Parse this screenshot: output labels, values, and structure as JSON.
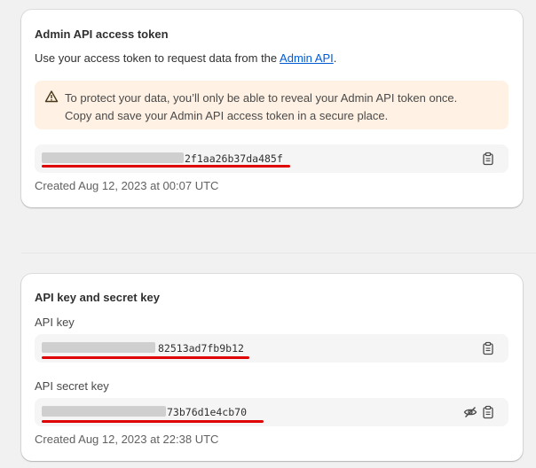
{
  "access_token_card": {
    "title": "Admin API access token",
    "description_prefix": "Use your access token to request data from the ",
    "description_link": "Admin API",
    "description_suffix": ".",
    "warning_line1": "To protect your data, you’ll only be able to reveal your Admin API token once.",
    "warning_line2": "Copy and save your Admin API access token in a secure place.",
    "token_visible_suffix": "2f1aa26b37da485f",
    "created": "Created Aug 12, 2023 at 00:07 UTC",
    "copy_icon": "clipboard-icon",
    "warning_icon": "warning-icon"
  },
  "keys_card": {
    "title": "API key and secret key",
    "api_key_label": "API key",
    "api_key_visible_suffix": "82513ad7fb9b12",
    "api_secret_label": "API secret key",
    "api_secret_visible_suffix": "73b76d1e4cb70",
    "created": "Created Aug 12, 2023 at 22:38 UTC",
    "hide_icon": "eye-slash-icon",
    "copy_icon": "clipboard-icon"
  },
  "colors": {
    "banner_bg": "#fff1e3",
    "link": "#005bd3",
    "redaction_line": "#e00000"
  }
}
